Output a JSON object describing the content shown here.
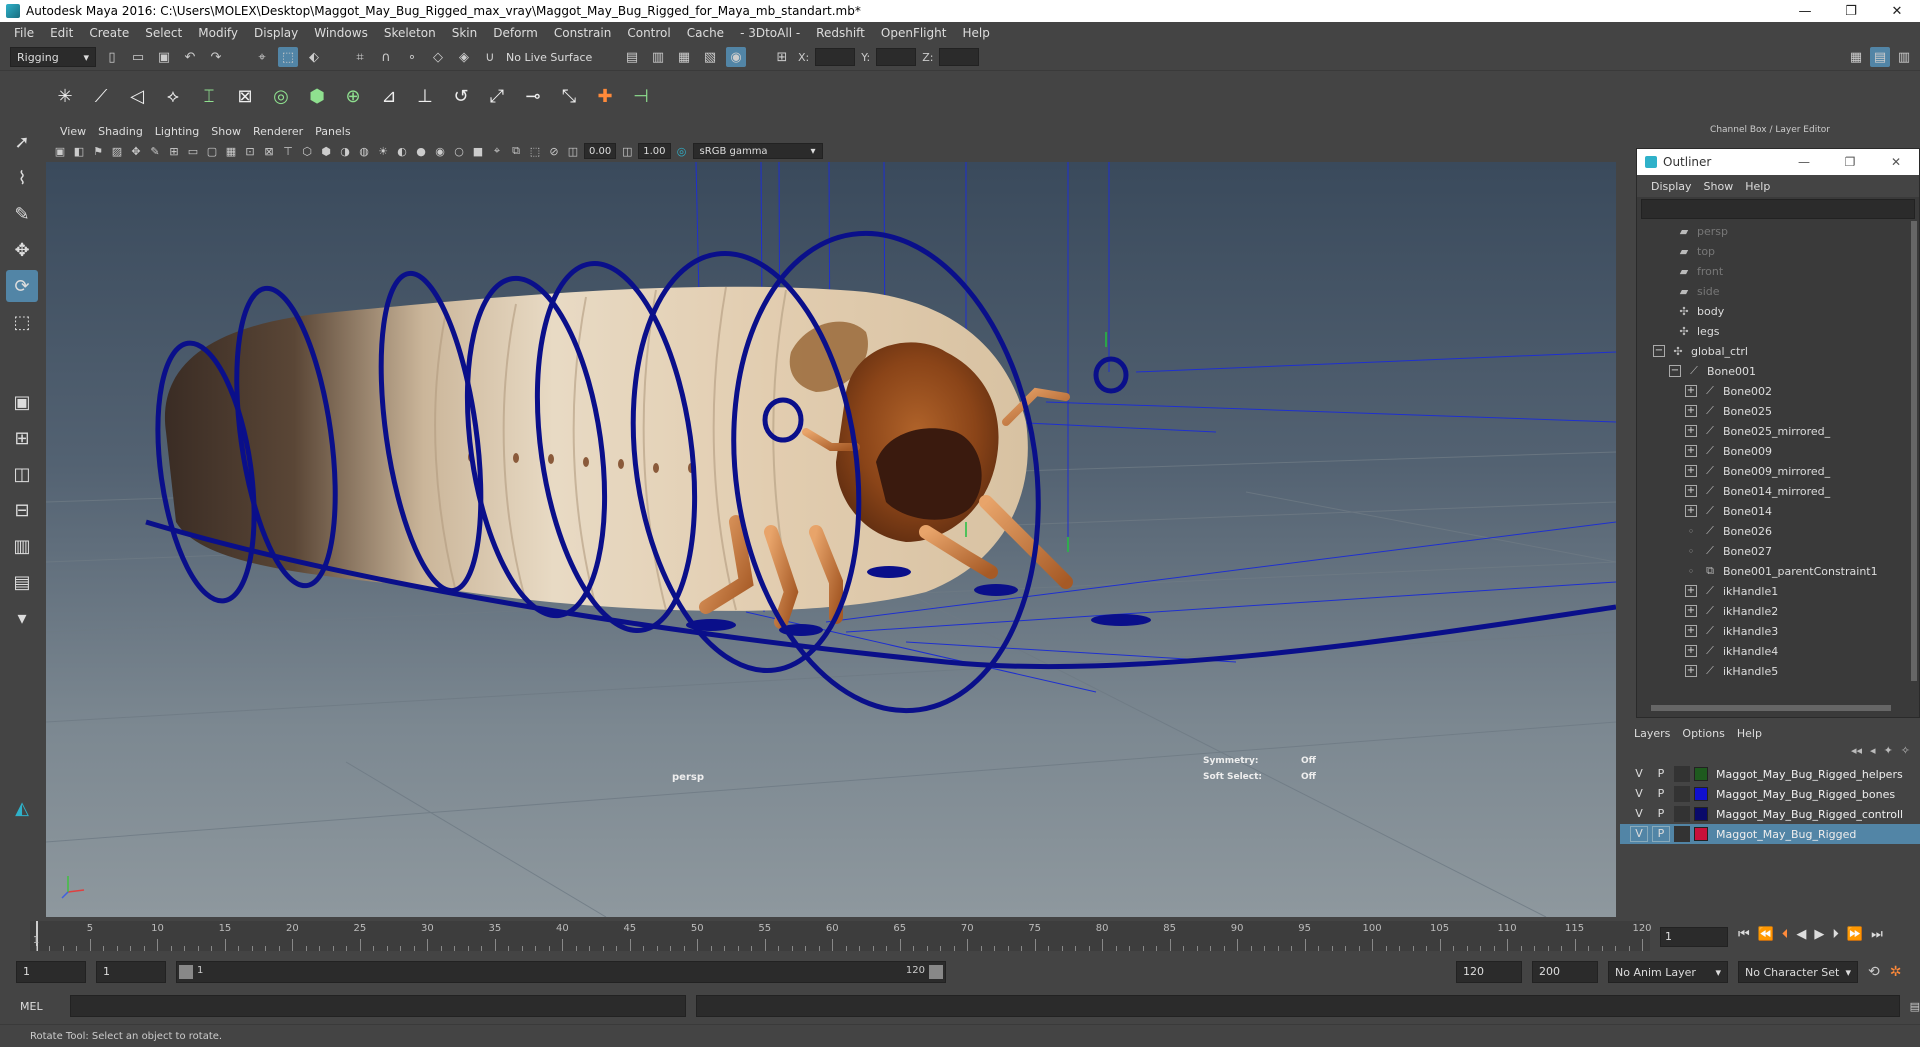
{
  "window": {
    "title": "Autodesk Maya 2016: C:\\Users\\MOLEX\\Desktop\\Maggot_May_Bug_Rigged_max_vray\\Maggot_May_Bug_Rigged_for_Maya_mb_standart.mb*",
    "minimize": "—",
    "restore": "❐",
    "close": "✕"
  },
  "menubar": [
    "File",
    "Edit",
    "Create",
    "Select",
    "Modify",
    "Display",
    "Windows",
    "Skeleton",
    "Skin",
    "Deform",
    "Constrain",
    "Control",
    "Cache",
    "- 3DtoAll -",
    "Redshift",
    "OpenFlight",
    "Help"
  ],
  "statusline": {
    "menuset": "Rigging",
    "live_surface": "No Live Surface",
    "x_label": "X:",
    "y_label": "Y:",
    "z_label": "Z:"
  },
  "viewport": {
    "menu": [
      "View",
      "Shading",
      "Lighting",
      "Show",
      "Renderer",
      "Panels"
    ],
    "near_value": "0.00",
    "far_value": "1.00",
    "color_space": "sRGB gamma",
    "camera_label": "persp",
    "symmetry_label": "Symmetry:",
    "symmetry_value": "Off",
    "soft_select_label": "Soft Select:",
    "soft_select_value": "Off"
  },
  "channel_box": {
    "header": "Channel Box / Layer Editor"
  },
  "outliner": {
    "title": "Outliner",
    "menu": [
      "Display",
      "Show",
      "Help"
    ],
    "items": [
      {
        "label": "persp",
        "indent": 0,
        "type": "camera",
        "dim": true
      },
      {
        "label": "top",
        "indent": 0,
        "type": "camera",
        "dim": true
      },
      {
        "label": "front",
        "indent": 0,
        "type": "camera",
        "dim": true
      },
      {
        "label": "side",
        "indent": 0,
        "type": "camera",
        "dim": true
      },
      {
        "label": "body",
        "indent": 0,
        "type": "mesh"
      },
      {
        "label": "legs",
        "indent": 0,
        "type": "mesh"
      },
      {
        "label": "global_ctrl",
        "indent": 0,
        "type": "ctrl",
        "expand": "minus"
      },
      {
        "label": "Bone001",
        "indent": 1,
        "type": "joint",
        "expand": "minus"
      },
      {
        "label": "Bone002",
        "indent": 2,
        "type": "joint",
        "expand": "plus"
      },
      {
        "label": "Bone025",
        "indent": 2,
        "type": "joint",
        "expand": "plus"
      },
      {
        "label": "Bone025_mirrored_",
        "indent": 2,
        "type": "joint",
        "expand": "plus"
      },
      {
        "label": "Bone009",
        "indent": 2,
        "type": "joint",
        "expand": "plus"
      },
      {
        "label": "Bone009_mirrored_",
        "indent": 2,
        "type": "joint",
        "expand": "plus"
      },
      {
        "label": "Bone014_mirrored_",
        "indent": 2,
        "type": "joint",
        "expand": "plus"
      },
      {
        "label": "Bone014",
        "indent": 2,
        "type": "joint",
        "expand": "plus"
      },
      {
        "label": "Bone026",
        "indent": 2,
        "type": "joint",
        "expand": "none"
      },
      {
        "label": "Bone027",
        "indent": 2,
        "type": "joint",
        "expand": "none"
      },
      {
        "label": "Bone001_parentConstraint1",
        "indent": 2,
        "type": "constraint",
        "expand": "none"
      },
      {
        "label": "ikHandle1",
        "indent": 2,
        "type": "ik",
        "expand": "plus"
      },
      {
        "label": "ikHandle2",
        "indent": 2,
        "type": "ik",
        "expand": "plus"
      },
      {
        "label": "ikHandle3",
        "indent": 2,
        "type": "ik",
        "expand": "plus"
      },
      {
        "label": "ikHandle4",
        "indent": 2,
        "type": "ik",
        "expand": "plus"
      },
      {
        "label": "ikHandle5",
        "indent": 2,
        "type": "ik",
        "expand": "plus"
      }
    ]
  },
  "layers": {
    "menu": [
      "Layers",
      "Options",
      "Help"
    ],
    "rows": [
      {
        "v": "V",
        "p": "P",
        "color": "#1e5a1e",
        "name": "Maggot_May_Bug_Rigged_helpers",
        "selected": false
      },
      {
        "v": "V",
        "p": "P",
        "color": "#1010d0",
        "name": "Maggot_May_Bug_Rigged_bones",
        "selected": false
      },
      {
        "v": "V",
        "p": "P",
        "color": "#0a0a6a",
        "name": "Maggot_May_Bug_Rigged_controll",
        "selected": false
      },
      {
        "v": "V",
        "p": "P",
        "color": "#c8103a",
        "name": "Maggot_May_Bug_Rigged",
        "selected": true
      }
    ]
  },
  "timeline": {
    "ticks": [
      5,
      10,
      15,
      20,
      25,
      30,
      35,
      40,
      45,
      50,
      55,
      60,
      65,
      70,
      75,
      80,
      85,
      90,
      95,
      100,
      105,
      110,
      115,
      120
    ],
    "start_tick": "1",
    "min": 1,
    "max": 120,
    "current_frame": "1"
  },
  "range": {
    "start": "1",
    "playback_start": "1",
    "range_start_label": "1",
    "range_end_label": "120",
    "playback_end": "120",
    "end": "200",
    "anim_layer": "No Anim Layer",
    "character_set": "No Character Set"
  },
  "command": {
    "label": "MEL"
  },
  "helpline": "Rotate Tool: Select an object to rotate."
}
